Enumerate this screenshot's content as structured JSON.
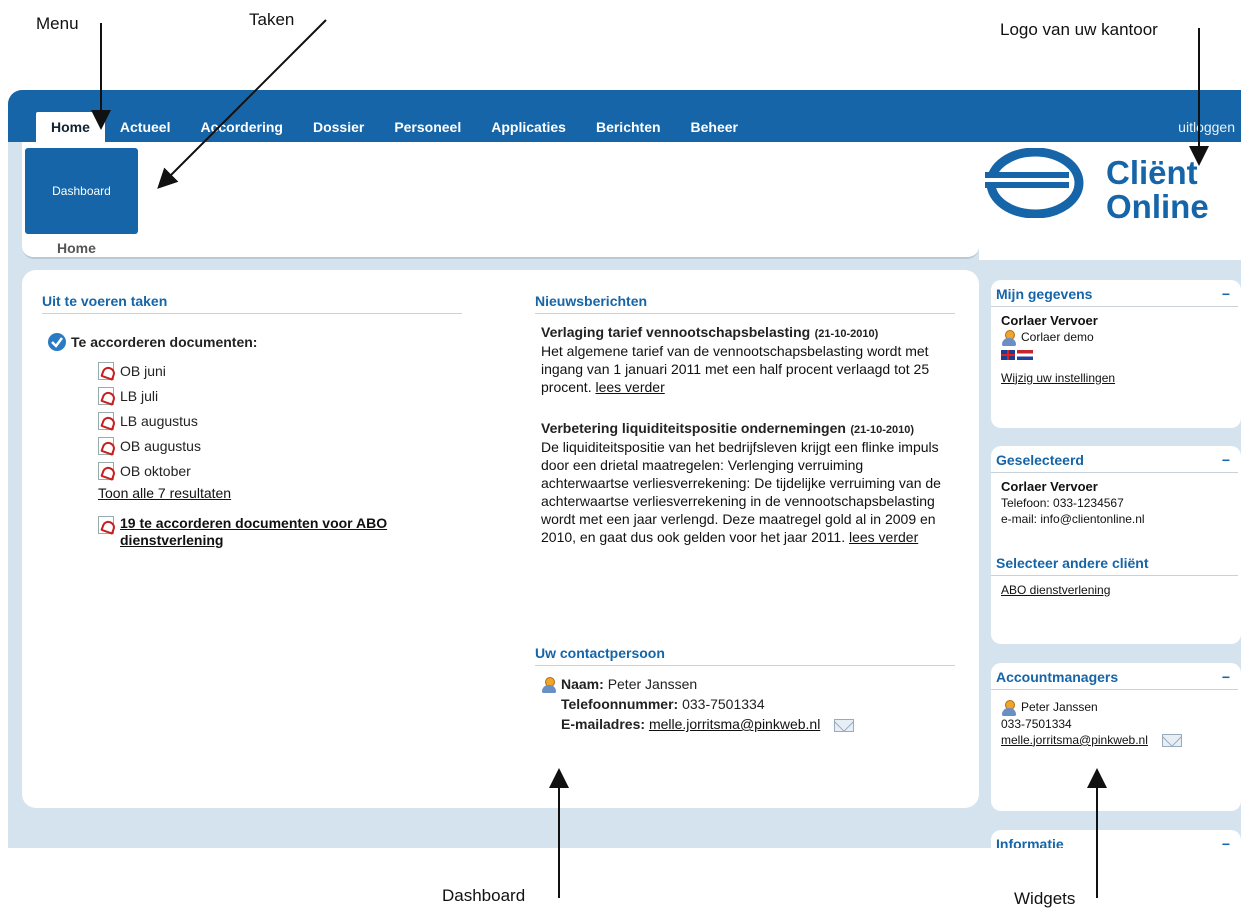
{
  "callouts": {
    "menu": "Menu",
    "taken": "Taken",
    "logo": "Logo van uw kantoor",
    "dashboard": "Dashboard",
    "widgets": "Widgets"
  },
  "nav": {
    "items": [
      "Home",
      "Actueel",
      "Accordering",
      "Dossier",
      "Personeel",
      "Applicaties",
      "Berichten",
      "Beheer"
    ],
    "active": "Home",
    "logout": "uitloggen"
  },
  "tasks": {
    "tile_label": "Dashboard",
    "breadcrumb": "Home"
  },
  "logo": {
    "line1": "Cliënt",
    "line2": "Online"
  },
  "todo": {
    "title": "Uit te voeren taken",
    "group_label": "Te accorderen documenten:",
    "documents": [
      "OB juni",
      "LB juli",
      "LB augustus",
      "OB augustus",
      "OB oktober"
    ],
    "show_all": "Toon alle 7 resultaten",
    "abo_link": "19 te accorderen documenten voor ABO dienstverlening"
  },
  "news": {
    "title": "Nieuwsberichten",
    "items": [
      {
        "title": "Verlaging tarief vennootschapsbelasting",
        "date": "(21-10-2010)",
        "body": "Het algemene tarief van de vennootschapsbelasting wordt met ingang van 1 januari 2011 met een half procent verlaagd tot 25 procent.",
        "more": "lees verder"
      },
      {
        "title": "Verbetering liquiditeitspositie ondernemingen",
        "date": "(21-10-2010)",
        "body": "De liquiditeitspositie van het bedrijfsleven krijgt een flinke impuls door een drietal maatregelen: Verlenging verruiming achterwaartse verliesverrekening: De tijdelijke verruiming van de achterwaartse verliesverrekening in de vennootschapsbelasting wordt met een jaar verlengd. Deze maatregel gold al in 2009 en 2010, en gaat dus ook gelden voor het jaar 2011.",
        "more": "lees verder"
      }
    ]
  },
  "contact": {
    "title": "Uw contactpersoon",
    "name_label": "Naam:",
    "name": "Peter Janssen",
    "phone_label": "Telefoonnummer:",
    "phone": "033-7501334",
    "email_label": "E-mailadres:",
    "email": "melle.jorritsma@pinkweb.nl"
  },
  "widgets": {
    "mijn": {
      "title": "Mijn gegevens",
      "company": "Corlaer Vervoer",
      "user": "Corlaer demo",
      "settings": "Wijzig uw instellingen"
    },
    "geselecteerd": {
      "title": "Geselecteerd",
      "company": "Corlaer Vervoer",
      "phone": "Telefoon: 033-1234567",
      "email": "e-mail: info@clientonline.nl",
      "select_title": "Selecteer andere cliënt",
      "other": "ABO dienstverlening"
    },
    "accountmanagers": {
      "title": "Accountmanagers",
      "name": "Peter Janssen",
      "phone": "033-7501334",
      "email": "melle.jorritsma@pinkweb.nl"
    },
    "informatie": {
      "title": "Informatie"
    },
    "minimize": "−"
  },
  "colors": {
    "primary": "#1565a8",
    "background": "#d5e3ee"
  }
}
